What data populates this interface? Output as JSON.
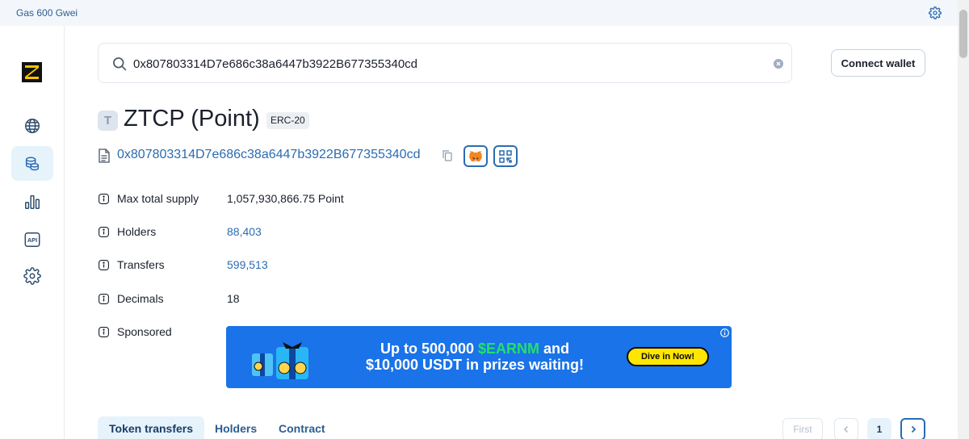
{
  "topbar": {
    "gas_label": "Gas 600 Gwei",
    "settings_icon": "gear-icon"
  },
  "sidebar": {
    "items": [
      {
        "name": "globe-icon",
        "active": false
      },
      {
        "name": "coins-icon",
        "active": true
      },
      {
        "name": "bar-chart-icon",
        "active": false
      },
      {
        "name": "api-icon",
        "active": false,
        "label": "API"
      },
      {
        "name": "gear-icon",
        "active": false
      }
    ]
  },
  "search": {
    "value": "0x807803314D7e686c38a6447b3922B677355340cd"
  },
  "header": {
    "connect_label": "Connect wallet"
  },
  "token": {
    "badge": "T",
    "title": "ZTCP (Point)",
    "standard": "ERC-20",
    "address": "0x807803314D7e686c38a6447b3922B677355340cd"
  },
  "details": {
    "rows": [
      {
        "label": "Max total supply",
        "value": "1,057,930,866.75 Point"
      },
      {
        "label": "Holders",
        "value": "88,403"
      },
      {
        "label": "Transfers",
        "value": "599,513"
      },
      {
        "label": "Decimals",
        "value": "18"
      },
      {
        "label": "Sponsored",
        "value": ""
      }
    ]
  },
  "ad": {
    "line1_prefix": "Up to 500,000 ",
    "line1_highlight": "$EARNM",
    "line1_suffix": " and",
    "line2": "$10,000 USDT in prizes waiting!",
    "cta": "Dive in Now!",
    "accent": "#22e06b",
    "background": "#1a73e8"
  },
  "tabs": [
    {
      "label": "Token transfers",
      "active": true
    },
    {
      "label": "Holders",
      "active": false
    },
    {
      "label": "Contract",
      "active": false
    }
  ],
  "pagination": {
    "first_label": "First",
    "current_page": "1"
  },
  "colors": {
    "link": "#2b6cb0",
    "active_bg": "#e6f3fb"
  }
}
